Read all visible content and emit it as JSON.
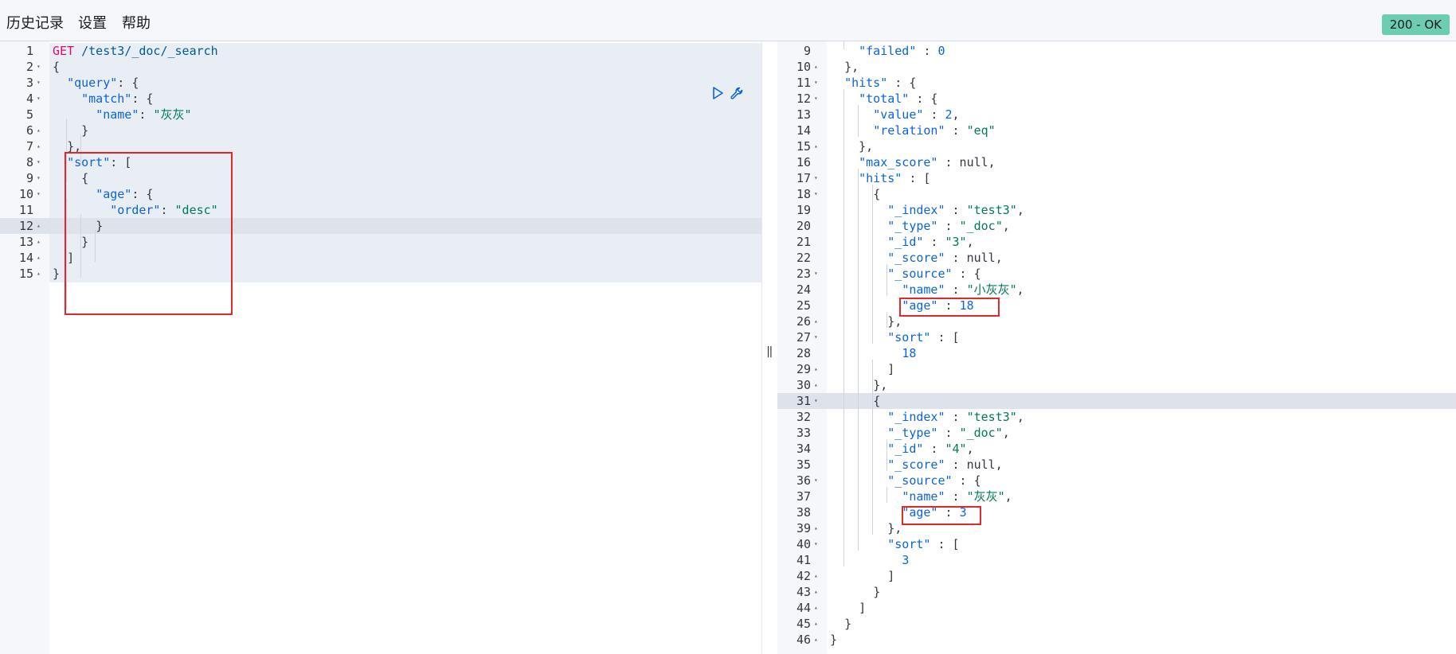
{
  "menu": {
    "history": "历史记录",
    "settings": "设置",
    "help": "帮助"
  },
  "status": "200 - OK",
  "colors": {
    "status_badge": "#6dccb1",
    "keyword": "#0b64dd",
    "string": "#007a5a",
    "method": "#dd0a73",
    "highlight_box": "#e2282b"
  },
  "icons": {
    "play": "play-icon",
    "wrench": "wrench-icon",
    "divider": "resize-handle-icon"
  },
  "request": {
    "lines": [
      {
        "n": "1",
        "fold": "",
        "html": "<span class=\"m\">GET</span> <span class=\"u\">/test3/_doc/_search</span>"
      },
      {
        "n": "2",
        "fold": "▾",
        "html": "<span class=\"p\">{</span>"
      },
      {
        "n": "3",
        "fold": "▾",
        "html": "  <span class=\"k\">\"query\"</span><span class=\"p\">: {</span>"
      },
      {
        "n": "4",
        "fold": "▾",
        "html": "    <span class=\"k\">\"match\"</span><span class=\"p\">: {</span>"
      },
      {
        "n": "5",
        "fold": "",
        "html": "      <span class=\"k\">\"name\"</span><span class=\"p\">: </span><span class=\"s\">\"灰灰\"</span>"
      },
      {
        "n": "6",
        "fold": "▴",
        "html": "    <span class=\"p\">}</span>"
      },
      {
        "n": "7",
        "fold": "▴",
        "html": "  <span class=\"p\">},</span>"
      },
      {
        "n": "8",
        "fold": "▾",
        "html": "  <span class=\"k\">\"sort\"</span><span class=\"p\">: [</span>"
      },
      {
        "n": "9",
        "fold": "▾",
        "html": "    <span class=\"p\">{</span>"
      },
      {
        "n": "10",
        "fold": "▾",
        "html": "      <span class=\"k\">\"age\"</span><span class=\"p\">: {</span>"
      },
      {
        "n": "11",
        "fold": "",
        "html": "        <span class=\"k\">\"order\"</span><span class=\"p\">: </span><span class=\"s\">\"desc\"</span>"
      },
      {
        "n": "12",
        "fold": "▴",
        "html": "      <span class=\"p\">}</span>"
      },
      {
        "n": "13",
        "fold": "▴",
        "html": "    <span class=\"p\">}</span>"
      },
      {
        "n": "14",
        "fold": "▴",
        "html": "  <span class=\"p\">]</span>"
      },
      {
        "n": "15",
        "fold": "▴",
        "html": "<span class=\"p\">}</span>"
      }
    ]
  },
  "response": {
    "lines": [
      {
        "n": "9",
        "fold": "",
        "html": "    <span class=\"k\">\"failed\"</span><span class=\"p\"> : </span><span class=\"n\">0</span>"
      },
      {
        "n": "10",
        "fold": "▴",
        "html": "  <span class=\"p\">},</span>"
      },
      {
        "n": "11",
        "fold": "▾",
        "html": "  <span class=\"k\">\"hits\"</span><span class=\"p\"> : {</span>"
      },
      {
        "n": "12",
        "fold": "▾",
        "html": "    <span class=\"k\">\"total\"</span><span class=\"p\"> : {</span>"
      },
      {
        "n": "13",
        "fold": "",
        "html": "      <span class=\"k\">\"value\"</span><span class=\"p\"> : </span><span class=\"n\">2</span><span class=\"p\">,</span>"
      },
      {
        "n": "14",
        "fold": "",
        "html": "      <span class=\"k\">\"relation\"</span><span class=\"p\"> : </span><span class=\"s\">\"eq\"</span>"
      },
      {
        "n": "15",
        "fold": "▴",
        "html": "    <span class=\"p\">},</span>"
      },
      {
        "n": "16",
        "fold": "",
        "html": "    <span class=\"k\">\"max_score\"</span><span class=\"p\"> : null,</span>"
      },
      {
        "n": "17",
        "fold": "▾",
        "html": "    <span class=\"k\">\"hits\"</span><span class=\"p\"> : [</span>"
      },
      {
        "n": "18",
        "fold": "▾",
        "html": "      <span class=\"p\">{</span>"
      },
      {
        "n": "19",
        "fold": "",
        "html": "        <span class=\"k\">\"_index\"</span><span class=\"p\"> : </span><span class=\"s\">\"test3\"</span><span class=\"p\">,</span>"
      },
      {
        "n": "20",
        "fold": "",
        "html": "        <span class=\"k\">\"_type\"</span><span class=\"p\"> : </span><span class=\"s\">\"_doc\"</span><span class=\"p\">,</span>"
      },
      {
        "n": "21",
        "fold": "",
        "html": "        <span class=\"k\">\"_id\"</span><span class=\"p\"> : </span><span class=\"s\">\"3\"</span><span class=\"p\">,</span>"
      },
      {
        "n": "22",
        "fold": "",
        "html": "        <span class=\"k\">\"_score\"</span><span class=\"p\"> : null,</span>"
      },
      {
        "n": "23",
        "fold": "▾",
        "html": "        <span class=\"k\">\"_source\"</span><span class=\"p\"> : {</span>"
      },
      {
        "n": "24",
        "fold": "",
        "html": "          <span class=\"k\">\"name\"</span><span class=\"p\"> : </span><span class=\"s\">\"小灰灰\"</span><span class=\"p\">,</span>"
      },
      {
        "n": "25",
        "fold": "",
        "html": "          <span class=\"k\">\"age\"</span><span class=\"p\"> : </span><span class=\"n\">18</span>"
      },
      {
        "n": "26",
        "fold": "▴",
        "html": "        <span class=\"p\">},</span>"
      },
      {
        "n": "27",
        "fold": "▾",
        "html": "        <span class=\"k\">\"sort\"</span><span class=\"p\"> : [</span>"
      },
      {
        "n": "28",
        "fold": "",
        "html": "          <span class=\"n\">18</span>"
      },
      {
        "n": "29",
        "fold": "▴",
        "html": "        <span class=\"p\">]</span>"
      },
      {
        "n": "30",
        "fold": "▴",
        "html": "      <span class=\"p\">},</span>"
      },
      {
        "n": "31",
        "fold": "▾",
        "html": "      <span class=\"p\">{</span>"
      },
      {
        "n": "32",
        "fold": "",
        "html": "        <span class=\"k\">\"_index\"</span><span class=\"p\"> : </span><span class=\"s\">\"test3\"</span><span class=\"p\">,</span>"
      },
      {
        "n": "33",
        "fold": "",
        "html": "        <span class=\"k\">\"_type\"</span><span class=\"p\"> : </span><span class=\"s\">\"_doc\"</span><span class=\"p\">,</span>"
      },
      {
        "n": "34",
        "fold": "",
        "html": "        <span class=\"k\">\"_id\"</span><span class=\"p\"> : </span><span class=\"s\">\"4\"</span><span class=\"p\">,</span>"
      },
      {
        "n": "35",
        "fold": "",
        "html": "        <span class=\"k\">\"_score\"</span><span class=\"p\"> : null,</span>"
      },
      {
        "n": "36",
        "fold": "▾",
        "html": "        <span class=\"k\">\"_source\"</span><span class=\"p\"> : {</span>"
      },
      {
        "n": "37",
        "fold": "",
        "html": "          <span class=\"k\">\"name\"</span><span class=\"p\"> : </span><span class=\"s\">\"灰灰\"</span><span class=\"p\">,</span>"
      },
      {
        "n": "38",
        "fold": "",
        "html": "          <span class=\"k\">\"age\"</span><span class=\"p\"> : </span><span class=\"n\">3</span>"
      },
      {
        "n": "39",
        "fold": "▴",
        "html": "        <span class=\"p\">},</span>"
      },
      {
        "n": "40",
        "fold": "▾",
        "html": "        <span class=\"k\">\"sort\"</span><span class=\"p\"> : [</span>"
      },
      {
        "n": "41",
        "fold": "",
        "html": "          <span class=\"n\">3</span>"
      },
      {
        "n": "42",
        "fold": "▴",
        "html": "        <span class=\"p\">]</span>"
      },
      {
        "n": "43",
        "fold": "▴",
        "html": "      <span class=\"p\">}</span>"
      },
      {
        "n": "44",
        "fold": "▴",
        "html": "    <span class=\"p\">]</span>"
      },
      {
        "n": "45",
        "fold": "▴",
        "html": "  <span class=\"p\">}</span>"
      },
      {
        "n": "46",
        "fold": "▴",
        "html": "<span class=\"p\">}</span>"
      }
    ]
  }
}
